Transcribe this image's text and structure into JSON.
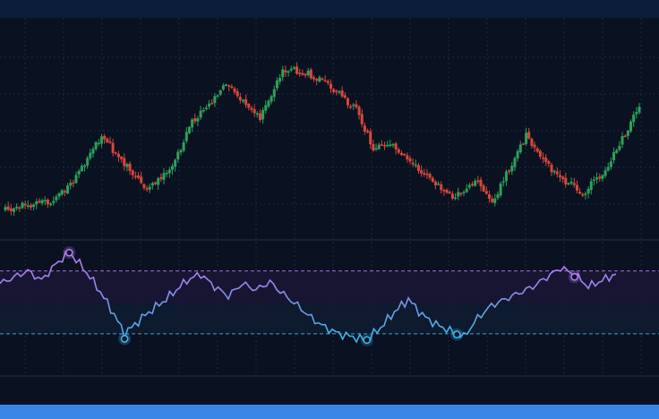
{
  "colors": {
    "background": "#0a1120",
    "header": "#0c1d3b",
    "footer": "#3a86e6",
    "grid": "#1e2c40",
    "bull": "#2ea15a",
    "bear": "#d8473b",
    "rsi_high": "#b07bf0",
    "rsi_low": "#3fb2e8",
    "overbought_band": "#1a1636",
    "oversold_band": "#0f1c30"
  },
  "chart_data": [
    {
      "type": "candlestick",
      "grid": true,
      "legend": "none",
      "anchors": [
        [
          0,
          3
        ],
        [
          18,
          6
        ],
        [
          26,
          14
        ],
        [
          34,
          26
        ],
        [
          42,
          17
        ],
        [
          50,
          9
        ],
        [
          58,
          15
        ],
        [
          66,
          30
        ],
        [
          78,
          42
        ],
        [
          90,
          31
        ],
        [
          98,
          47
        ],
        [
          106,
          46
        ],
        [
          114,
          42
        ],
        [
          124,
          34
        ],
        [
          130,
          22
        ],
        [
          136,
          24
        ],
        [
          148,
          14
        ],
        [
          158,
          6
        ],
        [
          166,
          12
        ],
        [
          172,
          5
        ],
        [
          184,
          26
        ],
        [
          194,
          14
        ],
        [
          204,
          8
        ],
        [
          212,
          15
        ],
        [
          224,
          35
        ]
      ],
      "ylim": [
        0,
        50
      ]
    },
    {
      "type": "line",
      "grid": true,
      "legend": "none",
      "overbought": 70,
      "oversold": 30,
      "ylim": [
        0,
        100
      ],
      "anchors": [
        [
          0,
          62
        ],
        [
          4,
          66
        ],
        [
          8,
          70
        ],
        [
          12,
          64
        ],
        [
          16,
          74
        ],
        [
          20,
          82
        ],
        [
          24,
          72
        ],
        [
          28,
          60
        ],
        [
          32,
          46
        ],
        [
          36,
          30
        ],
        [
          42,
          42
        ],
        [
          48,
          52
        ],
        [
          54,
          64
        ],
        [
          58,
          68
        ],
        [
          62,
          60
        ],
        [
          66,
          54
        ],
        [
          70,
          62
        ],
        [
          74,
          58
        ],
        [
          78,
          63
        ],
        [
          82,
          55
        ],
        [
          86,
          48
        ],
        [
          90,
          40
        ],
        [
          94,
          34
        ],
        [
          98,
          30
        ],
        [
          102,
          28
        ],
        [
          106,
          26
        ],
        [
          110,
          34
        ],
        [
          114,
          44
        ],
        [
          118,
          52
        ],
        [
          122,
          42
        ],
        [
          126,
          36
        ],
        [
          130,
          32
        ],
        [
          134,
          28
        ],
        [
          138,
          40
        ],
        [
          142,
          48
        ],
        [
          146,
          52
        ],
        [
          150,
          56
        ],
        [
          154,
          60
        ],
        [
          158,
          66
        ],
        [
          162,
          72
        ],
        [
          166,
          68
        ],
        [
          170,
          60
        ],
        [
          174,
          64
        ],
        [
          178,
          68
        ]
      ],
      "markers": [
        {
          "index": 20,
          "zone": "high"
        },
        {
          "index": 36,
          "zone": "low"
        },
        {
          "index": 106,
          "zone": "low"
        },
        {
          "index": 132,
          "zone": "low"
        },
        {
          "index": 166,
          "zone": "high"
        }
      ]
    }
  ]
}
